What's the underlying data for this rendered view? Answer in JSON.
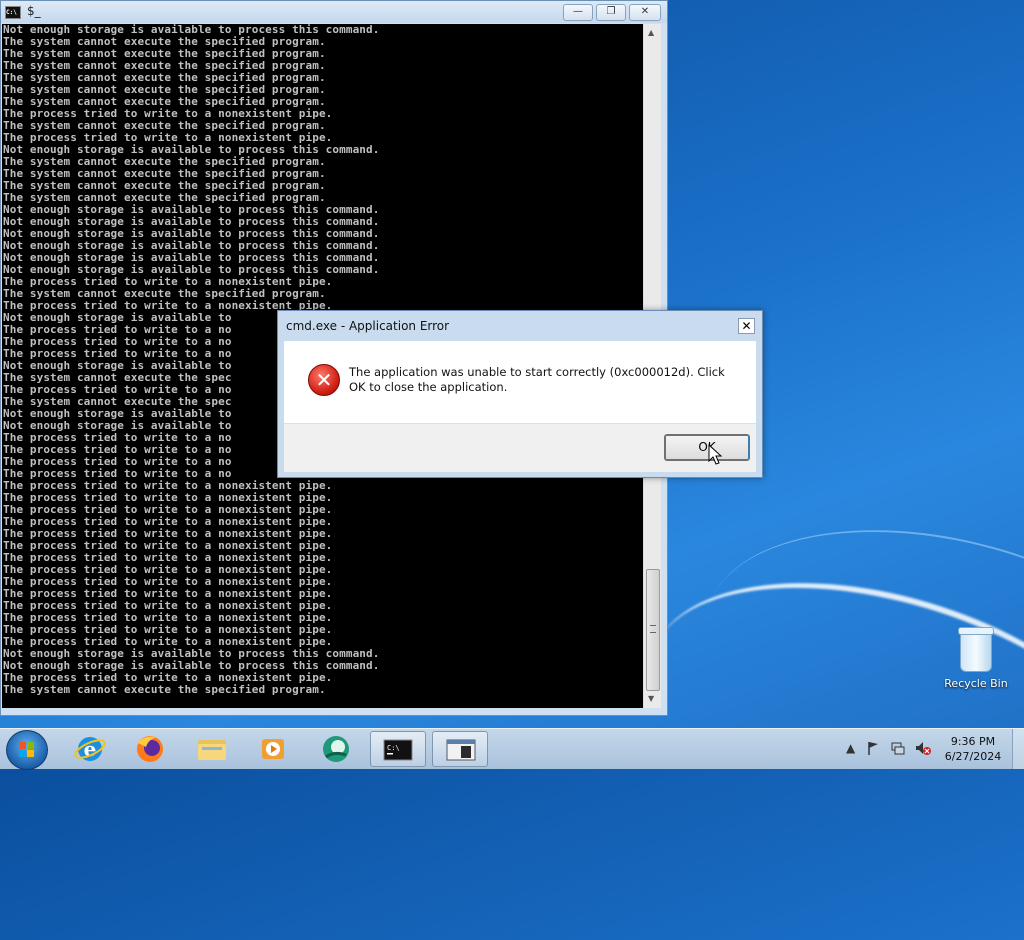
{
  "console": {
    "title": "$_",
    "icon_label": "C:\\",
    "lines": [
      "Not enough storage is available to process this command.",
      "The system cannot execute the specified program.",
      "The system cannot execute the specified program.",
      "The system cannot execute the specified program.",
      "The system cannot execute the specified program.",
      "The system cannot execute the specified program.",
      "The system cannot execute the specified program.",
      "The process tried to write to a nonexistent pipe.",
      "The system cannot execute the specified program.",
      "The process tried to write to a nonexistent pipe.",
      "Not enough storage is available to process this command.",
      "The system cannot execute the specified program.",
      "The system cannot execute the specified program.",
      "The system cannot execute the specified program.",
      "The system cannot execute the specified program.",
      "Not enough storage is available to process this command.",
      "Not enough storage is available to process this command.",
      "Not enough storage is available to process this command.",
      "Not enough storage is available to process this command.",
      "Not enough storage is available to process this command.",
      "Not enough storage is available to process this command.",
      "The process tried to write to a nonexistent pipe.",
      "The system cannot execute the specified program.",
      "The process tried to write to a nonexistent pipe.",
      "Not enough storage is available to",
      "The process tried to write to a no",
      "The process tried to write to a no",
      "The process tried to write to a no",
      "Not enough storage is available to",
      "The system cannot execute the spec",
      "The process tried to write to a no",
      "The system cannot execute the spec",
      "Not enough storage is available to",
      "Not enough storage is available to",
      "The process tried to write to a no",
      "The process tried to write to a no",
      "The process tried to write to a no",
      "The process tried to write to a no",
      "The process tried to write to a nonexistent pipe.",
      "The process tried to write to a nonexistent pipe.",
      "The process tried to write to a nonexistent pipe.",
      "The process tried to write to a nonexistent pipe.",
      "The process tried to write to a nonexistent pipe.",
      "The process tried to write to a nonexistent pipe.",
      "The process tried to write to a nonexistent pipe.",
      "The process tried to write to a nonexistent pipe.",
      "The process tried to write to a nonexistent pipe.",
      "The process tried to write to a nonexistent pipe.",
      "The process tried to write to a nonexistent pipe.",
      "The process tried to write to a nonexistent pipe.",
      "The process tried to write to a nonexistent pipe.",
      "The process tried to write to a nonexistent pipe.",
      "Not enough storage is available to process this command.",
      "Not enough storage is available to process this command.",
      "The process tried to write to a nonexistent pipe.",
      "The system cannot execute the specified program."
    ]
  },
  "dialog": {
    "title": "cmd.exe - Application Error",
    "message": "The application was unable to start correctly (0xc000012d). Click OK to close the application.",
    "ok_label": "OK",
    "close_glyph": "✕",
    "error_glyph": "✕"
  },
  "desktop": {
    "recycle_bin_label": "Recycle Bin"
  },
  "taskbar": {
    "clock_time": "9:36 PM",
    "clock_date": "6/27/2024",
    "pinned": [
      "internet-explorer",
      "firefox",
      "file-explorer",
      "media-player",
      "app-circle",
      "command-prompt",
      "window-app"
    ]
  }
}
